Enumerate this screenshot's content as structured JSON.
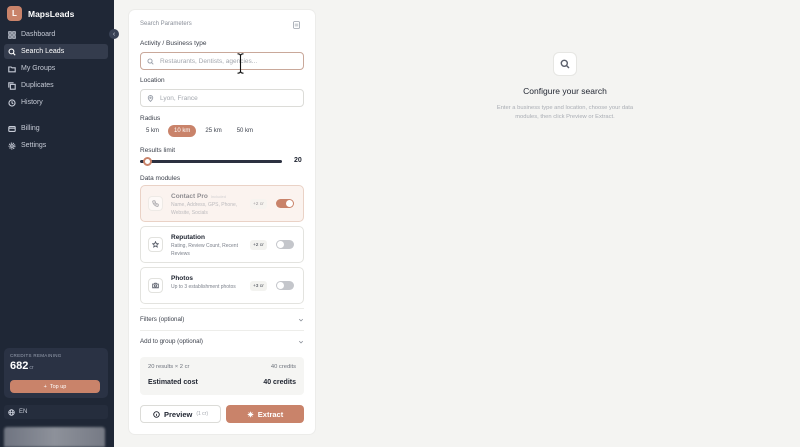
{
  "app": {
    "logo_letter": "L",
    "name": "MapsLeads"
  },
  "sidebar": {
    "items": [
      {
        "label": "Dashboard",
        "icon": "grid-icon"
      },
      {
        "label": "Search Leads",
        "icon": "search-icon"
      },
      {
        "label": "My Groups",
        "icon": "folder-icon"
      },
      {
        "label": "Duplicates",
        "icon": "copy-icon"
      },
      {
        "label": "History",
        "icon": "history-icon"
      },
      {
        "label": "Billing",
        "icon": "card-icon"
      },
      {
        "label": "Settings",
        "icon": "gear-icon"
      }
    ],
    "credits": {
      "label": "CREDITS REMAINING",
      "value": "682",
      "unit": "cr",
      "topup_label": "Top up"
    },
    "language": "EN"
  },
  "panel": {
    "title": "Search Parameters",
    "activity_label": "Activity / Business type",
    "activity_placeholder": "Restaurants, Dentists, agencies...",
    "location_label": "Location",
    "location_placeholder": "Lyon, France",
    "radius_label": "Radius",
    "radius_options": [
      "5 km",
      "10 km",
      "25 km",
      "50 km"
    ],
    "radius_selected": "10 km",
    "results_limit_label": "Results limit",
    "results_limit_value": "20",
    "results_limit_fraction": 0.02,
    "data_modules_label": "Data modules",
    "modules": [
      {
        "name": "Contact Pro",
        "badge": "Included",
        "desc": "Name, Address, GPS, Phone, Website, Socials",
        "cost": "+2 cr",
        "enabled": true
      },
      {
        "name": "Reputation",
        "badge": "",
        "desc": "Rating, Review Count, Recent Reviews",
        "cost": "+2 cr",
        "enabled": false
      },
      {
        "name": "Photos",
        "badge": "",
        "desc": "Up to 3 establishment photos",
        "cost": "+3 cr",
        "enabled": false
      }
    ],
    "filters_label": "Filters (optional)",
    "group_label": "Add to group (optional)",
    "summary": {
      "calc_label": "20 results × 2 cr",
      "calc_value": "40 credits",
      "estimated_label": "Estimated cost",
      "estimated_value": "40 credits"
    },
    "preview_label": "Preview",
    "preview_cost": "(1 cr)",
    "extract_label": "Extract"
  },
  "empty_state": {
    "title": "Configure your search",
    "description": "Enter a business type and location, choose your data modules, then click Preview or Extract."
  },
  "colors": {
    "sidebar_bg": "#1f2736",
    "accent": "#c9836a",
    "page_bg": "#f4f4f2"
  }
}
